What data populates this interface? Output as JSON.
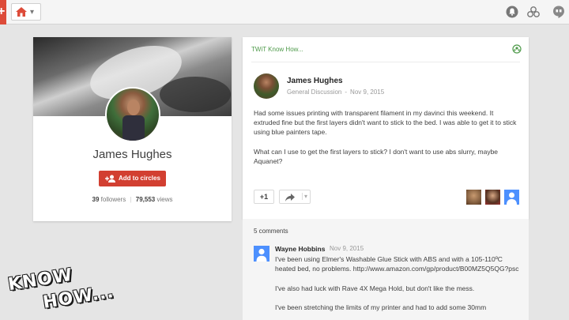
{
  "colors": {
    "brand_red": "#dd4b39",
    "accent_green": "#4e9a4a",
    "link_blue": "#4d90fe"
  },
  "topbar": {
    "plus_glyph": "+",
    "home_icon": "home-icon",
    "home_chevron": "▾",
    "icons": [
      "notifications-icon",
      "share-icon",
      "hangouts-icon"
    ]
  },
  "profile": {
    "name": "James Hughes",
    "add_button": "Add to circles",
    "followers_count": "39",
    "followers_label": "followers",
    "views_count": "79,553",
    "views_label": "views"
  },
  "post": {
    "community": "TWiT Know How...",
    "author": "James Hughes",
    "category": "General Discussion",
    "date": "Nov 9, 2015",
    "body": [
      "Had some issues printing with transparent filament in my davinci this weekend. It extruded fine but the first layers didn't want to stick to the bed. I was able to get it to stick using blue painters tape.",
      "What can I use to get the first layers to stick? I don't want to use abs slurry, maybe Aquanet?"
    ],
    "plus_one": "+1",
    "share_chevron": "▾"
  },
  "comments": {
    "count_label": "5 comments",
    "items": [
      {
        "author": "Wayne Hobbins",
        "date": "Nov 9, 2015",
        "text": [
          "I've been using Elmer's Washable Glue Stick with ABS and with a 105-110ºC heated bed, no problems. http://www.amazon.com/gp/product/B00MZ5Q5QG?psc",
          "I've also had luck with Rave 4X Mega Hold, but don't like the mess.",
          "I've been stretching the limits of my printer and had to add some 30mm"
        ]
      }
    ]
  },
  "watermark": {
    "line1": "KNOW",
    "line2": "HOW..."
  }
}
